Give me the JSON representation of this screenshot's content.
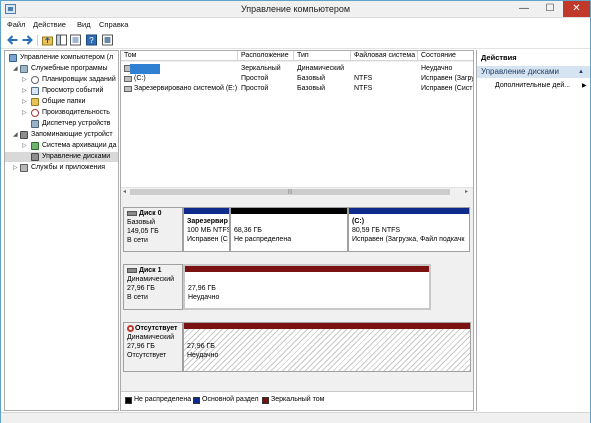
{
  "window": {
    "title": "Управление компьютером",
    "min_glyph": "—",
    "max_glyph": "☐",
    "close_glyph": "✕"
  },
  "menu": [
    "Файл",
    "Действие",
    "Вид",
    "Справка"
  ],
  "tree": [
    {
      "label": "Управление компьютером (л",
      "level": 0,
      "twisty": ""
    },
    {
      "label": "Служебные программы",
      "level": 1,
      "twisty": "◢"
    },
    {
      "label": "Планировщик заданий",
      "level": 2,
      "twisty": "▷"
    },
    {
      "label": "Просмотр событий",
      "level": 2,
      "twisty": "▷"
    },
    {
      "label": "Общие папки",
      "level": 2,
      "twisty": "▷"
    },
    {
      "label": "Производительность",
      "level": 2,
      "twisty": "▷"
    },
    {
      "label": "Диспетчер устройств",
      "level": 2,
      "twisty": ""
    },
    {
      "label": "Запоминающие устройст",
      "level": 1,
      "twisty": "◢"
    },
    {
      "label": "Система архивации да",
      "level": 2,
      "twisty": "▷"
    },
    {
      "label": "Управление дисками",
      "level": 2,
      "twisty": "",
      "selected": true
    },
    {
      "label": "Службы и приложения",
      "level": 1,
      "twisty": "▷"
    }
  ],
  "grid": {
    "columns": [
      "Том",
      "Расположение",
      "Тип",
      "Файловая система",
      "Состояние"
    ],
    "rows": [
      {
        "volume": "",
        "layout": "Зеркальный",
        "type": "Динамический",
        "fs": "",
        "status": "Неудачно",
        "highlight": true
      },
      {
        "volume": "(C:)",
        "layout": "Простой",
        "type": "Базовый",
        "fs": "NTFS",
        "status": "Исправен (Загру"
      },
      {
        "volume": "Зарезервировано системой (E:)",
        "layout": "Простой",
        "type": "Базовый",
        "fs": "NTFS",
        "status": "Исправен (Сист"
      }
    ]
  },
  "disks": [
    {
      "name": "Диск 0",
      "kind": "Базовый",
      "size": "149,05 ГБ",
      "state": "В сети",
      "partitions": [
        {
          "title": "Зарезервир",
          "line1": "100 МБ NTFS",
          "line2": "Исправен (С",
          "color": "#0d2a8c"
        },
        {
          "title": "",
          "line1": "68,36 ГБ",
          "line2": "Не распределена",
          "color": "#000000"
        },
        {
          "title": "(C:)",
          "line1": "80,59 ГБ NTFS",
          "line2": "Исправен (Загрузка, Файл подкачк",
          "color": "#0d2a8c"
        }
      ]
    },
    {
      "name": "Диск 1",
      "kind": "Динамический",
      "size": "27,96 ГБ",
      "state": "В сети",
      "partitions": [
        {
          "title": "",
          "line1": "27,96 ГБ",
          "line2": "Неудачно",
          "color": "#7a1212"
        }
      ]
    },
    {
      "name": "Отсутствует",
      "kind": "Динамический",
      "size": "27,96 ГБ",
      "state": "Отсутствует",
      "partitions": [
        {
          "title": "",
          "line1": "27,96 ГБ",
          "line2": "Неудачно",
          "color": "#7a1212"
        }
      ]
    }
  ],
  "legend": [
    {
      "label": "Не распределена",
      "color": "#000000"
    },
    {
      "label": "Основной раздел",
      "color": "#0d2a8c"
    },
    {
      "label": "Зеркальный том",
      "color": "#7a1212"
    }
  ],
  "actions": {
    "header": "Действия",
    "section": "Управление дисками",
    "section_arrow": "▲",
    "more": "Дополнительные дей...",
    "more_arrow": "▶"
  }
}
